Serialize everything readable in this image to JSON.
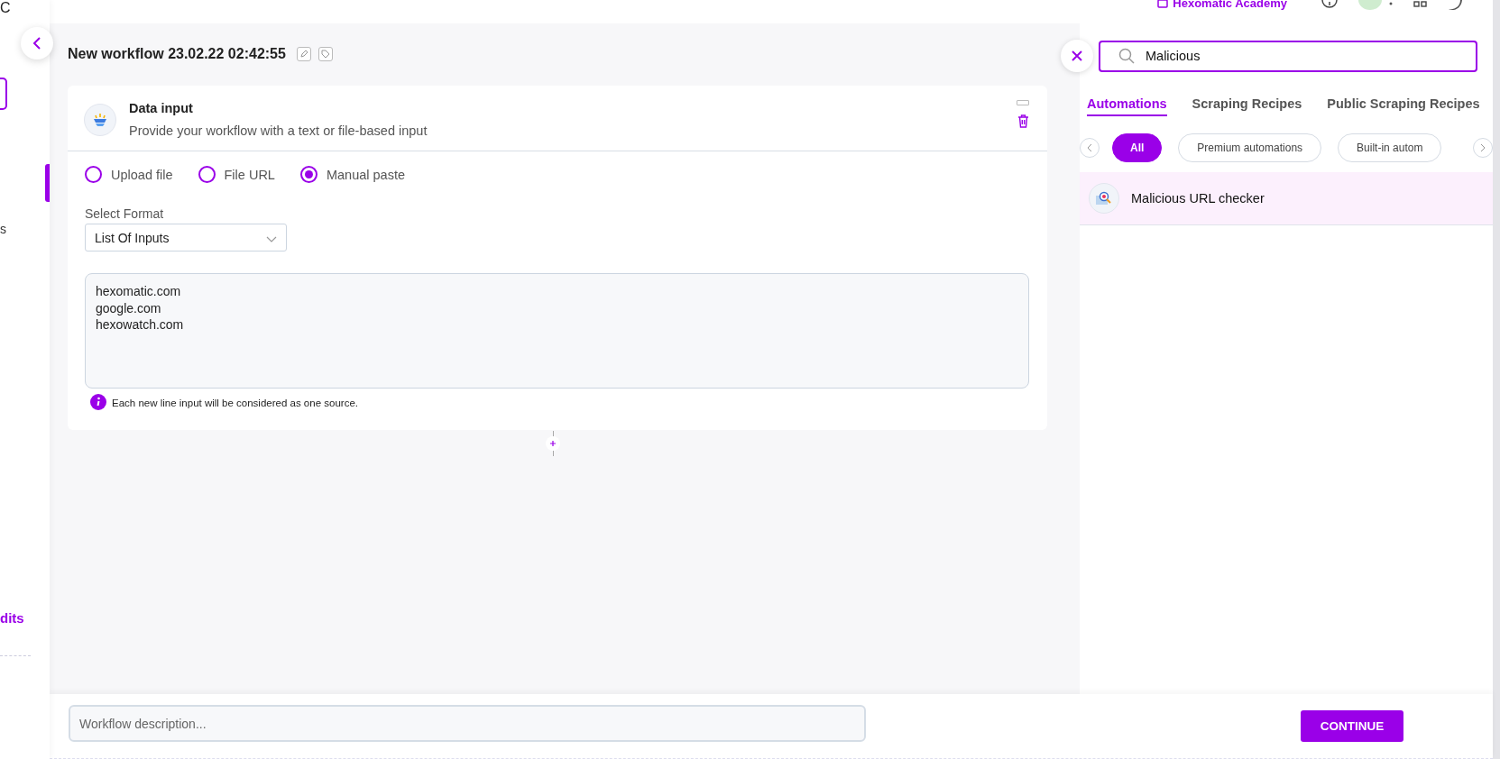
{
  "top_bar": {
    "academy_link": "Hexomatic Academy"
  },
  "sidebar": {
    "logo_fragment": "C",
    "item_fragment": "s",
    "credits_fragment": "dits"
  },
  "workflow": {
    "title": "New workflow 23.02.22 02:42:55"
  },
  "card": {
    "title": "Data input",
    "description": "Provide your workflow with a text or file-based input",
    "source_options": [
      {
        "label": "Upload file",
        "selected": false
      },
      {
        "label": "File URL",
        "selected": false
      },
      {
        "label": "Manual paste",
        "selected": true
      }
    ],
    "format_label": "Select Format",
    "format_value": "List Of Inputs",
    "input_lines": [
      "hexomatic.com",
      "google.com",
      "hexowatch.com"
    ],
    "hint": "Each new line input will be considered as one source."
  },
  "panel": {
    "search_value": "Malicious",
    "tabs": [
      {
        "label": "Automations",
        "selected": true
      },
      {
        "label": "Scraping Recipes",
        "selected": false
      },
      {
        "label": "Public Scraping Recipes",
        "selected": false
      }
    ],
    "chips": [
      {
        "label": "All",
        "selected": true
      },
      {
        "label": "Premium automations",
        "selected": false
      },
      {
        "label": "Built-in autom",
        "selected": false
      }
    ],
    "results": [
      {
        "name": "Malicious URL checker",
        "selected": true
      }
    ]
  },
  "bottom_bar": {
    "description_placeholder": "Workflow description...",
    "continue_button": "CONTINUE"
  }
}
